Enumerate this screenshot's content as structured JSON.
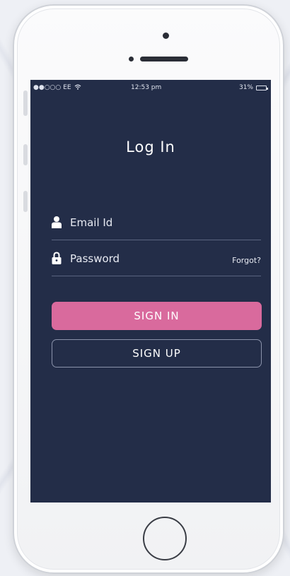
{
  "status_bar": {
    "carrier": "●●○○○ EE",
    "time": "12:53 pm",
    "battery": "31%",
    "battery_level": 0.31
  },
  "login": {
    "title": "Log In",
    "email_placeholder": "Email Id",
    "password_placeholder": "Password",
    "forgot_label": "Forgot?",
    "signin_label": "SIGN IN",
    "signup_label": "SIGN UP"
  },
  "colors": {
    "screen_bg": "#232d48",
    "signin_bg": "#d96a9d"
  },
  "icons": [
    "wifi-icon",
    "battery-icon",
    "user-icon",
    "lock-icon"
  ]
}
